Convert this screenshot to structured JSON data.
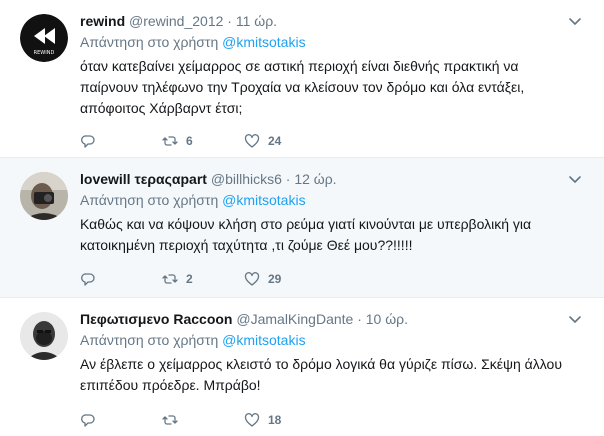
{
  "tweets": [
    {
      "name": "rewind",
      "handle": "@rewind_2012",
      "sep": "·",
      "time": "11 ώρ.",
      "reply_prefix": "Απάντηση στο χρήστη",
      "reply_mention": "@kmitsotakis",
      "text_lines": [
        "όταν κατεβαίνει χείμαρρος σε αστική περιοχή είναι διεθνής πρακτική να",
        "παίρνουν τηλέφωνο την Τροχαία να κλείσουν τον δρόμο και όλα εντάξει,",
        "απόφοιτος Χάρβαρντ έτσι;"
      ],
      "reply_count": "",
      "retweet_count": "6",
      "like_count": "24",
      "avatar_text": "REWIND"
    },
    {
      "name": "lovewill τεραςαpart",
      "handle": "@billhicks6",
      "sep": "·",
      "time": "12 ώρ.",
      "reply_prefix": "Απάντηση στο χρήστη",
      "reply_mention": "@kmitsotakis",
      "text_lines": [
        "Καθώς και να κόψουν κλήση στο ρεύμα γιατί κινούνται με υπερβολική για",
        "κατοικημένη περιοχή ταχύτητα ,τι ζούμε Θεέ μου??!!!!!"
      ],
      "reply_count": "",
      "retweet_count": "2",
      "like_count": "29"
    },
    {
      "name": "Πεφωτισμενο Raccoon",
      "handle": "@JamalKingDante",
      "sep": "·",
      "time": "10 ώρ.",
      "reply_prefix": "Απάντηση στο χρήστη",
      "reply_mention": "@kmitsotakis",
      "text_lines": [
        "Αν έβλεπε ο χείμαρρος κλειστό το δρόμο λογικά θα γύριζε πίσω. Σκέψη άλλου",
        "επιπέδου πρόεδρε. Μπράβο!"
      ],
      "reply_count": "",
      "retweet_count": "",
      "like_count": "18"
    }
  ],
  "colors": {
    "link": "#1da1f2",
    "muted": "#657786",
    "text": "#14171a",
    "highlight_bg": "#f5f8fa",
    "border": "#e6ecf0"
  },
  "icons": [
    "reply-icon",
    "retweet-icon",
    "like-icon",
    "chevron-down-icon"
  ]
}
